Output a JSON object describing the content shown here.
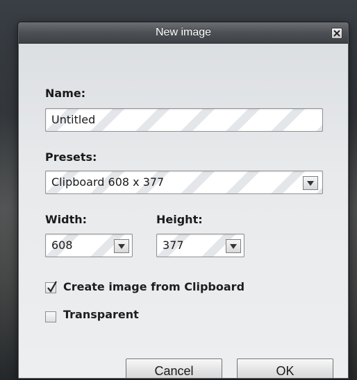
{
  "dialog": {
    "title": "New image"
  },
  "name": {
    "label": "Name:",
    "value": "Untitled"
  },
  "presets": {
    "label": "Presets:",
    "value": "Clipboard 608 x 377"
  },
  "width": {
    "label": "Width:",
    "value": "608"
  },
  "height": {
    "label": "Height:",
    "value": "377"
  },
  "options": {
    "clipboard": {
      "label": "Create image from Clipboard",
      "checked": true
    },
    "transparent": {
      "label": "Transparent",
      "checked": false
    }
  },
  "buttons": {
    "cancel": "Cancel",
    "ok": "OK"
  },
  "icons": {
    "close": "close-icon",
    "dropdown": "chevron-down-icon",
    "check": "checkmark-icon"
  }
}
